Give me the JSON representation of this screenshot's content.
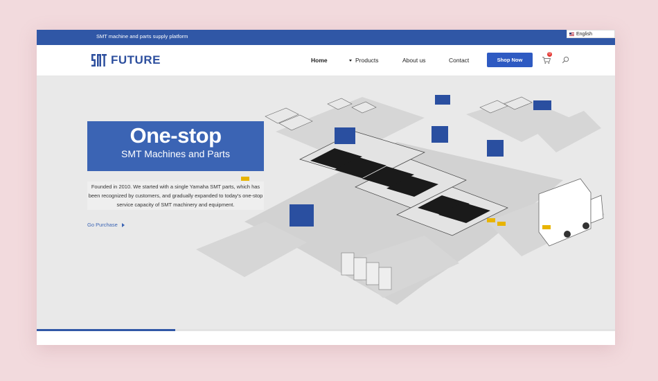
{
  "topbar": {
    "tagline": "SMT machine and parts supply platform",
    "language": "English"
  },
  "brand": {
    "name": "FUTURE",
    "logo_icon": "smt-logo-icon"
  },
  "nav": {
    "items": [
      {
        "label": "Home",
        "active": true
      },
      {
        "label": "Products",
        "has_dropdown": true
      },
      {
        "label": "About us"
      },
      {
        "label": "Contact"
      }
    ],
    "shop_button": "Shop Now",
    "cart_count": "0",
    "cart_icon": "cart-icon",
    "search_icon": "search-icon"
  },
  "hero": {
    "headline": "One-stop",
    "subheadline": "SMT Machines and Parts",
    "description": "Founded in 2010. We started with a single Yamaha SMT parts, which has been recognized by customers, and gradually expanded to today's one-stop service capacity of SMT machinery and equipment.",
    "cta": "Go Purchase",
    "slider_progress": 0.24
  },
  "colors": {
    "brand_blue": "#3057a6",
    "accent_blue": "#2e5ac2",
    "badge_red": "#e53935"
  }
}
